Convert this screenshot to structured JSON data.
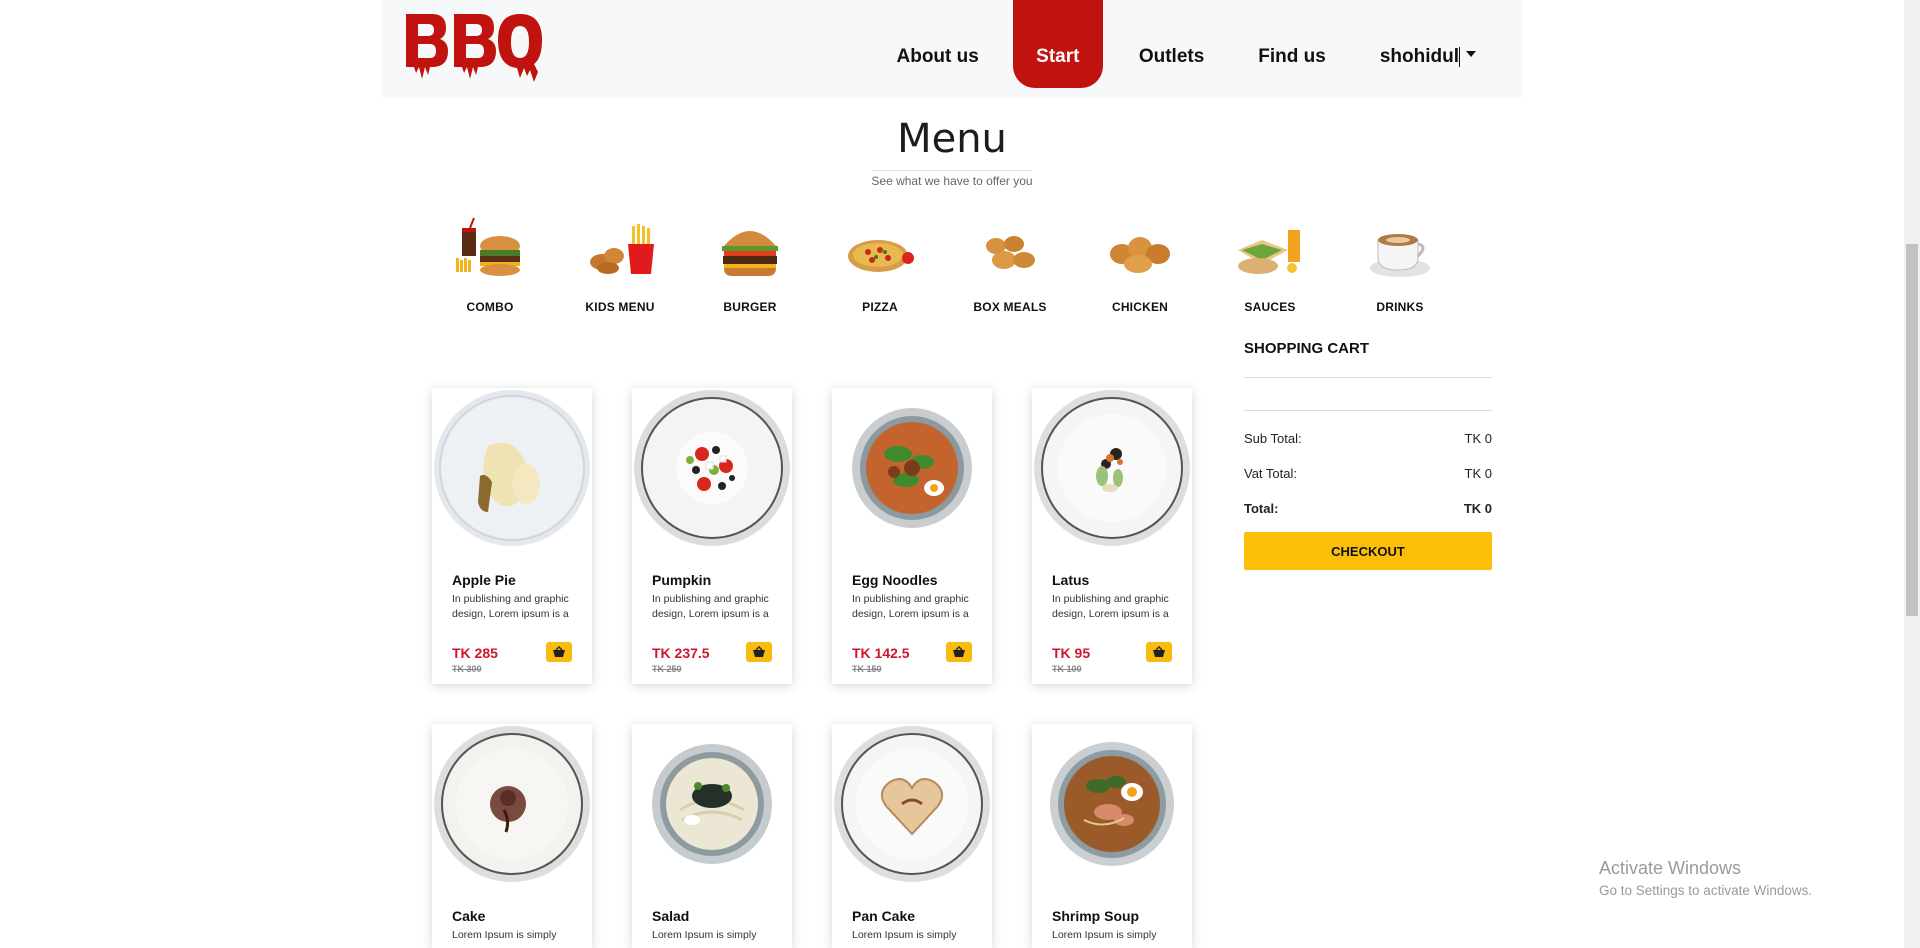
{
  "brand": {
    "logo_text": "BBQ",
    "accent": "#c0120f",
    "yellow": "#f8bd0c"
  },
  "nav": {
    "about": "About us",
    "start": "Start",
    "outlets": "Outlets",
    "find": "Find us",
    "user": "shohidul"
  },
  "menu": {
    "title": "Menu",
    "subtitle": "See what we have to offer you"
  },
  "categories": [
    {
      "label": "COMBO",
      "icon": "combo-icon"
    },
    {
      "label": "KIDS MENU",
      "icon": "kids-menu-icon"
    },
    {
      "label": "BURGER",
      "icon": "burger-icon"
    },
    {
      "label": "PIZZA",
      "icon": "pizza-icon"
    },
    {
      "label": "BOX MEALS",
      "icon": "box-meals-icon"
    },
    {
      "label": "CHICKEN",
      "icon": "chicken-icon"
    },
    {
      "label": "SAUCES",
      "icon": "sauces-icon"
    },
    {
      "label": "DRINKS",
      "icon": "drinks-icon"
    }
  ],
  "products": [
    {
      "name": "Apple Pie",
      "desc": "In publishing and graphic design, Lorem ipsum is a",
      "price": "TK 285",
      "old_price": "TK 300"
    },
    {
      "name": "Pumpkin",
      "desc": "In publishing and graphic design, Lorem ipsum is a",
      "price": "TK 237.5",
      "old_price": "TK 250"
    },
    {
      "name": "Egg Noodles",
      "desc": "In publishing and graphic design, Lorem ipsum is a",
      "price": "TK 142.5",
      "old_price": "TK 150"
    },
    {
      "name": "Latus",
      "desc": "In publishing and graphic design, Lorem ipsum is a",
      "price": "TK 95",
      "old_price": "TK 100"
    },
    {
      "name": "Cake",
      "desc": "Lorem Ipsum is simply"
    },
    {
      "name": "Salad",
      "desc": "Lorem Ipsum is simply"
    },
    {
      "name": "Pan Cake",
      "desc": "Lorem Ipsum is simply"
    },
    {
      "name": "Shrimp Soup",
      "desc": "Lorem Ipsum is simply"
    }
  ],
  "cart": {
    "title": "SHOPPING CART",
    "subtotal_label": "Sub Total:",
    "subtotal_value": "TK 0",
    "vat_label": "Vat Total:",
    "vat_value": "TK 0",
    "total_label": "Total:",
    "total_value": "TK 0",
    "checkout_label": "CHECKOUT"
  },
  "watermark": {
    "title": "Activate Windows",
    "subtitle": "Go to Settings to activate Windows."
  }
}
